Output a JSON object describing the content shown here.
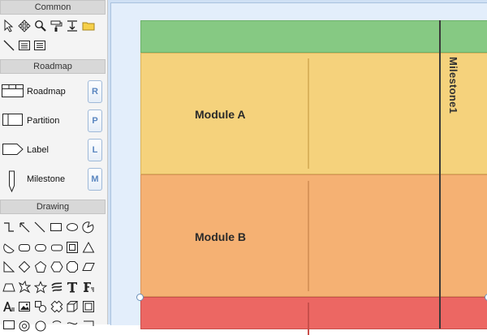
{
  "toolbox": {
    "sections": {
      "common": "Common",
      "roadmap": "Roadmap",
      "drawing": "Drawing"
    },
    "common_tools": [
      "pointer-icon",
      "pan-icon",
      "zoom-icon",
      "format-painter-icon",
      "insert-space-icon",
      "folder-icon",
      "line-icon",
      "text-block-icon",
      "list-block-icon"
    ],
    "roadmap_items": [
      {
        "label": "Roadmap",
        "key": "R",
        "icon": "roadmap-table-icon"
      },
      {
        "label": "Partition",
        "key": "P",
        "icon": "partition-icon"
      },
      {
        "label": "Label",
        "key": "L",
        "icon": "label-tag-icon"
      },
      {
        "label": "Milestone",
        "key": "M",
        "icon": "milestone-pin-icon"
      }
    ]
  },
  "canvas": {
    "bands": [
      {
        "name": "header",
        "label": "",
        "color": "#86c983"
      },
      {
        "name": "module-a",
        "label": "Module A",
        "color": "#f5d27c"
      },
      {
        "name": "module-b",
        "label": "Module B",
        "color": "#f5b173"
      },
      {
        "name": "module-c",
        "label": "",
        "color": "#ec6763"
      }
    ],
    "milestone": {
      "label": "Milestone1",
      "color": "#3a3a3a"
    }
  }
}
